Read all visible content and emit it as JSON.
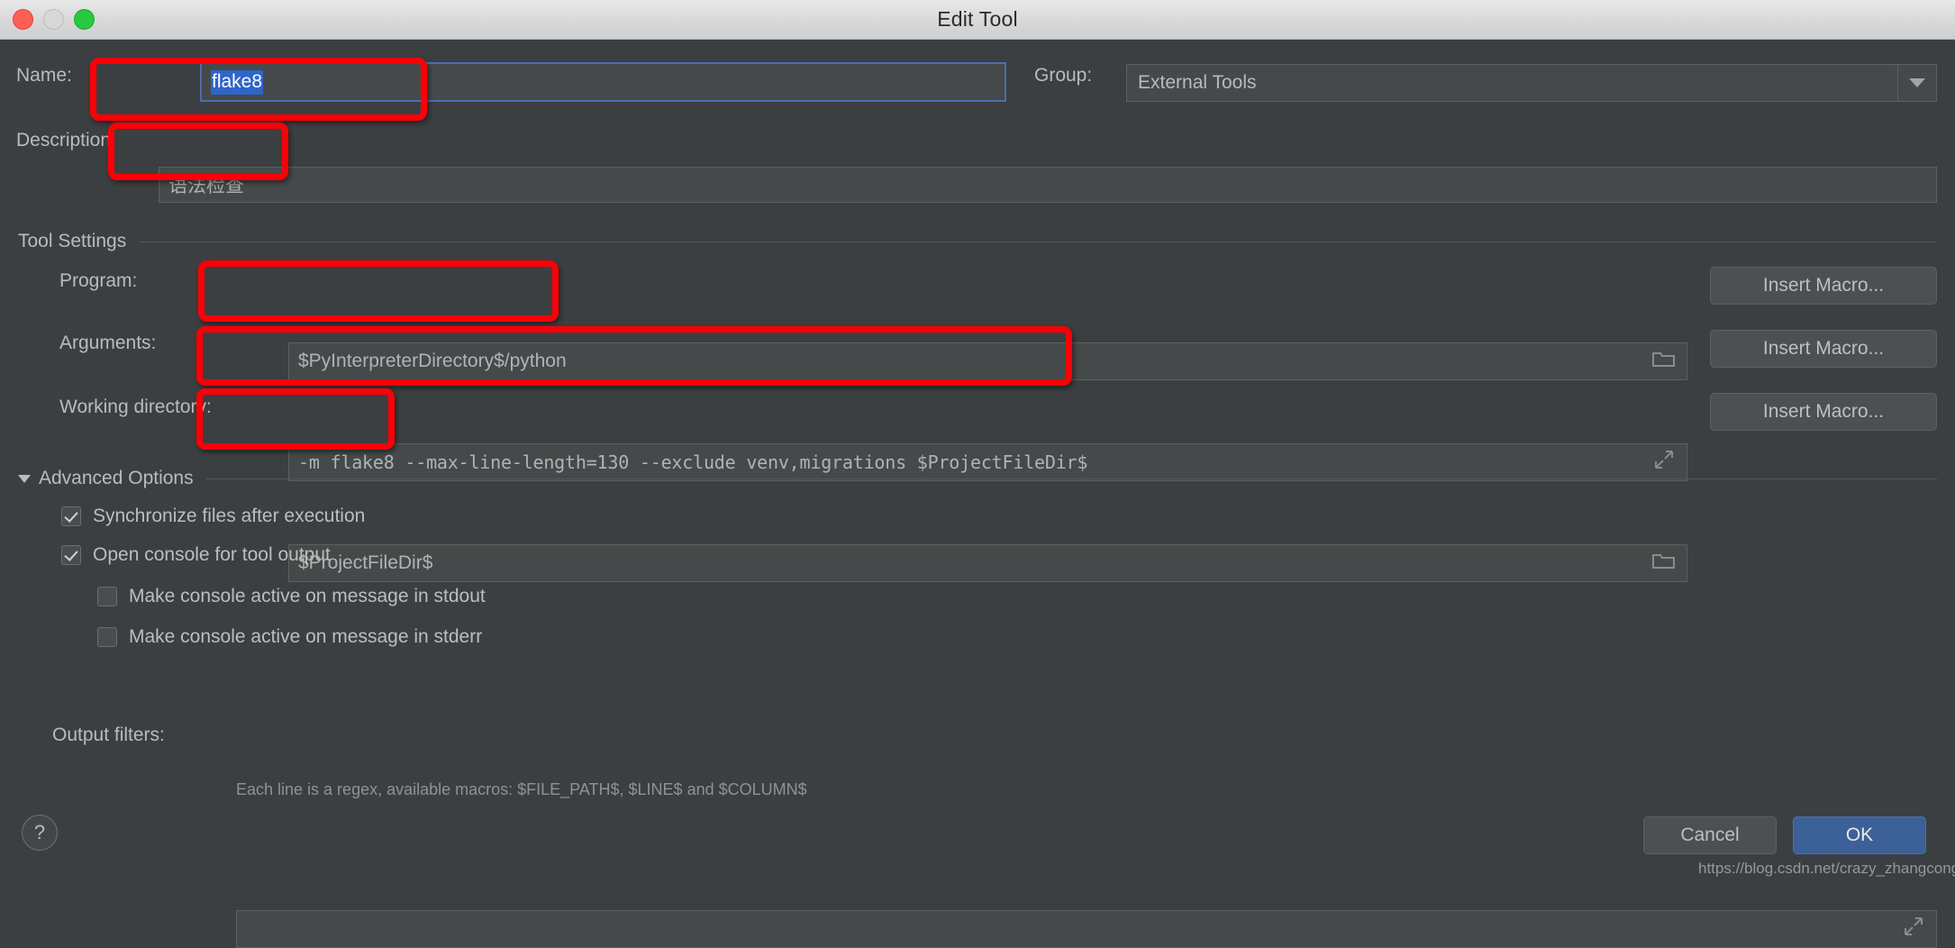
{
  "window": {
    "title": "Edit Tool",
    "traffic_lights": [
      "close-red",
      "minimize-grey",
      "maximize-green"
    ]
  },
  "form": {
    "name": {
      "label": "Name:",
      "value": "flake8",
      "selected": true,
      "focused": true
    },
    "description": {
      "label": "Description",
      "value": "语法检查"
    },
    "group": {
      "label": "Group:",
      "value": "External Tools",
      "options": [
        "External Tools"
      ]
    }
  },
  "tool_settings": {
    "section_label": "Tool Settings",
    "program": {
      "label": "Program:",
      "value": "$PyInterpreterDirectory$/python",
      "browse_icon": "folder-icon",
      "macro_button": "Insert Macro..."
    },
    "arguments": {
      "label": "Arguments:",
      "value": "-m flake8 --max-line-length=130 --exclude venv,migrations $ProjectFileDir$",
      "expand_icon": "expand-icon",
      "macro_button": "Insert Macro..."
    },
    "working_directory": {
      "label": "Working directory:",
      "value": "$ProjectFileDir$",
      "browse_icon": "folder-icon",
      "macro_button": "Insert Macro..."
    }
  },
  "advanced_options": {
    "section_label": "Advanced Options",
    "expanded": true,
    "checkboxes": [
      {
        "label": "Synchronize files after execution",
        "checked": true,
        "indent": 0
      },
      {
        "label": "Open console for tool output",
        "checked": true,
        "indent": 0
      },
      {
        "label": "Make console active on message in stdout",
        "checked": false,
        "indent": 1
      },
      {
        "label": "Make console active on message in stderr",
        "checked": false,
        "indent": 1
      }
    ],
    "output_filters": {
      "label": "Output filters:",
      "value": "",
      "expand_icon": "expand-icon",
      "hint": "Each line is a regex, available macros: $FILE_PATH$, $LINE$ and $COLUMN$"
    }
  },
  "footer": {
    "help_label": "?",
    "cancel_label": "Cancel",
    "ok_label": "OK"
  },
  "watermark": "https://blog.csdn.net/crazy_zhangcong",
  "colors": {
    "dialog_bg": "#3c3f41",
    "field_bg": "#45494a",
    "accent_blue": "#4b6eaf",
    "ok_button": "#3c6098",
    "selection_blue": "#2f65ca",
    "annotation_red": "#fb0007",
    "titlebar": "#d8d8d8"
  }
}
